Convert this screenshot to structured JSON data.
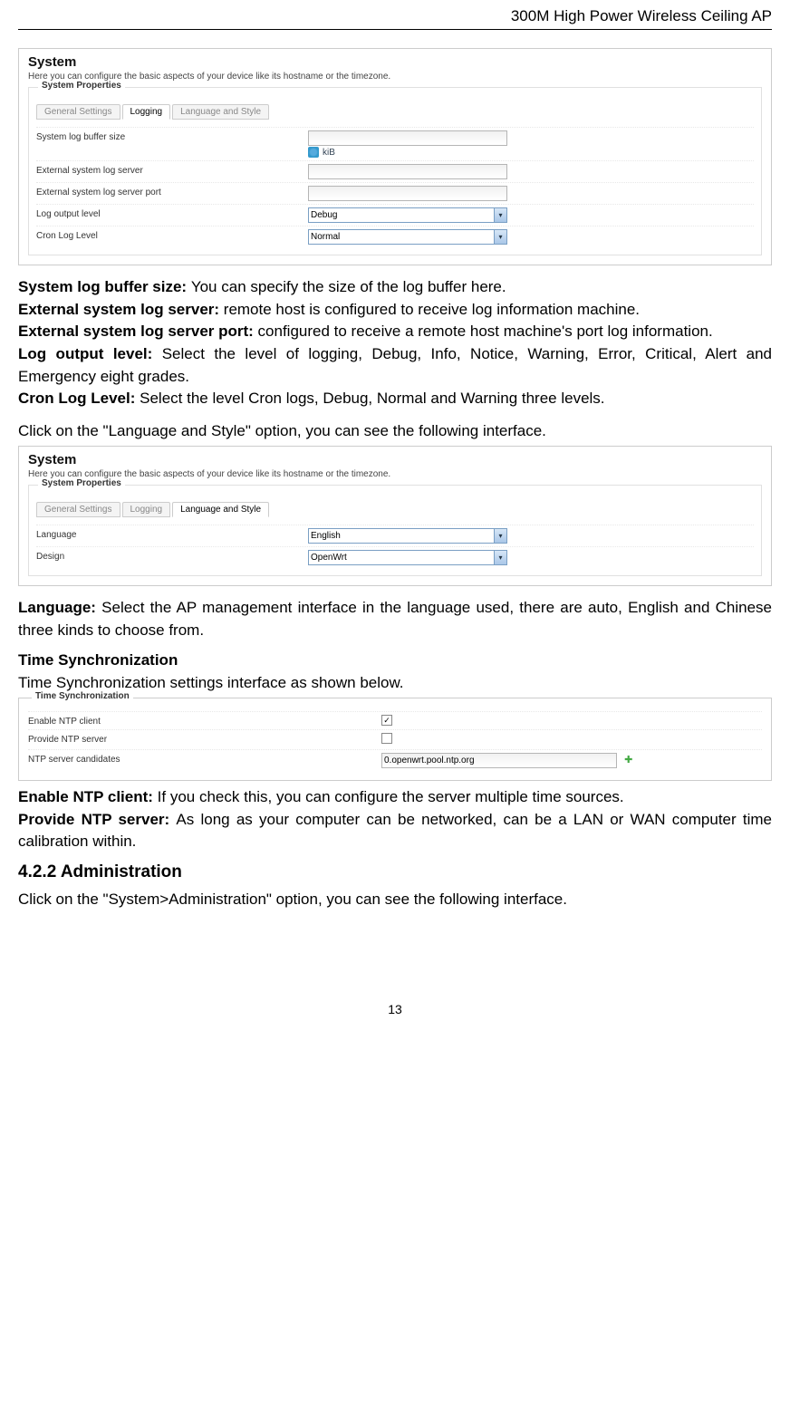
{
  "header": "300M High Power Wireless Ceiling AP",
  "page_number": "13",
  "panel1": {
    "title": "System",
    "desc": "Here you can configure the basic aspects of your device like its hostname or the timezone.",
    "legend": "System Properties",
    "tabs": [
      "General Settings",
      "Logging",
      "Language and Style"
    ],
    "active_tab": 1,
    "rows": {
      "buffer_label": "System log buffer size",
      "kib": "kiB",
      "ext_server_label": "External system log server",
      "ext_port_label": "External system log server port",
      "log_level_label": "Log output level",
      "log_level_value": "Debug",
      "cron_label": "Cron Log Level",
      "cron_value": "Normal"
    }
  },
  "desc1": {
    "buffer_b": "System log buffer size: ",
    "buffer_t": "You can specify the size of the log buffer here.",
    "ext_b": "External system log server: ",
    "ext_t": "remote host is configured to receive log information machine.",
    "port_b": "External system log server port: ",
    "port_t": "configured to receive a remote host machine's port log information.",
    "lvl_b": "Log output level: ",
    "lvl_t": "Select the level of logging, Debug, Info, Notice, Warning, Error, Critical, Alert and Emergency eight grades.",
    "cron_b": "Cron Log Level: ",
    "cron_t": "Select the level Cron logs, Debug, Normal and Warning three levels.",
    "lang_intro": "Click on the \"Language and Style\" option, you can see the following interface."
  },
  "panel2": {
    "title": "System",
    "desc": "Here you can configure the basic aspects of your device like its hostname or the timezone.",
    "legend": "System Properties",
    "tabs": [
      "General Settings",
      "Logging",
      "Language and Style"
    ],
    "active_tab": 2,
    "rows": {
      "lang_label": "Language",
      "lang_value": "English",
      "design_label": "Design",
      "design_value": "OpenWrt"
    }
  },
  "desc2": {
    "lang_b": "Language: ",
    "lang_t": "Select the AP management interface in the language used, there are auto, English and Chinese three kinds to choose from."
  },
  "time_sync": {
    "heading": "Time Synchronization",
    "intro": "Time Synchronization settings interface as shown below.",
    "legend": "Time Synchronization",
    "enable_label": "Enable NTP client",
    "provide_label": "Provide NTP server",
    "candidates_label": "NTP server candidates",
    "candidates_value": "0.openwrt.pool.ntp.org"
  },
  "desc3": {
    "enable_b": "Enable NTP client: ",
    "enable_t": "If you check this, you can configure the server multiple time sources.",
    "provide_b": "Provide NTP server: ",
    "provide_t": "As long as your computer can be networked, can be a LAN or WAN computer time calibration within."
  },
  "admin": {
    "heading": "4.2.2 Administration",
    "text": "Click on the \"System>Administration\" option, you can see the following interface."
  }
}
